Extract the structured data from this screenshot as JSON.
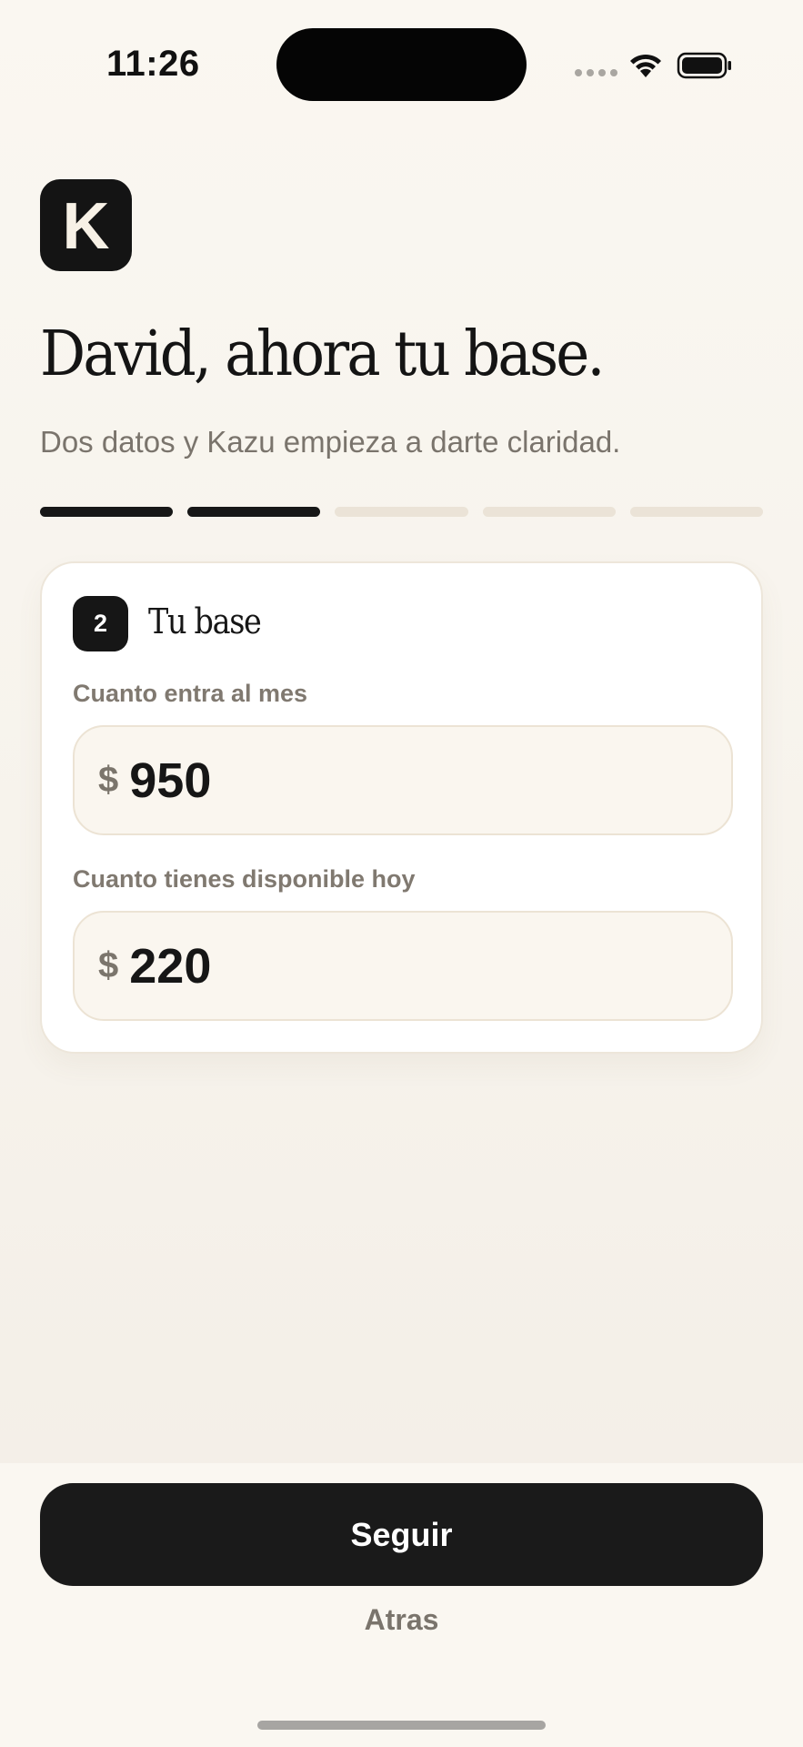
{
  "status_bar": {
    "time": "11:26"
  },
  "brand": {
    "logo_letter": "K"
  },
  "header": {
    "title": "David, ahora tu base.",
    "subtitle": "Dos datos y Kazu empieza a darte claridad."
  },
  "progress": {
    "total_steps": 5,
    "completed_steps": 2
  },
  "card": {
    "step_number": "2",
    "title": "Tu base",
    "fields": [
      {
        "label": "Cuanto entra al mes",
        "currency": "$",
        "value": "950"
      },
      {
        "label": "Cuanto tienes disponible hoy",
        "currency": "$",
        "value": "220"
      }
    ]
  },
  "actions": {
    "primary_label": "Seguir",
    "secondary_label": "Atras"
  },
  "colors": {
    "background": "#faf7f1",
    "primary": "#1a1a1a",
    "muted_text": "#7a746c",
    "progress_inactive": "#ebe3d7"
  }
}
